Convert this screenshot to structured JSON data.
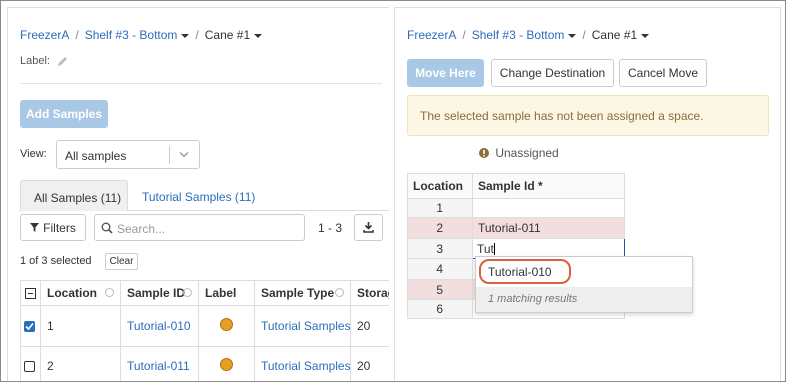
{
  "left": {
    "breadcrumb": {
      "freezer": "FreezerA",
      "shelf": "Shelf #3 - Bottom",
      "cane": "Cane #1"
    },
    "label_text": "Label:",
    "add_samples": "Add Samples",
    "view_label": "View:",
    "view_value": "All samples",
    "tabs": [
      {
        "label": "All Samples (11)"
      },
      {
        "label": "Tutorial Samples (11)"
      }
    ],
    "filters": "Filters",
    "search_placeholder": "Search...",
    "page_range": "1 - 3",
    "selected_text": "1 of 3 selected",
    "clear": "Clear",
    "columns": [
      "Location",
      "Sample ID",
      "Label",
      "Sample Type",
      "Storage"
    ],
    "rows": [
      {
        "location": "1",
        "sample_id": "Tutorial-010",
        "sample_type": "Tutorial Samples",
        "store": "20",
        "checked": true
      },
      {
        "location": "2",
        "sample_id": "Tutorial-011",
        "sample_type": "Tutorial Samples",
        "store": "20",
        "checked": false
      }
    ]
  },
  "right": {
    "breadcrumb": {
      "freezer": "FreezerA",
      "shelf": "Shelf #3 - Bottom",
      "cane": "Cane #1"
    },
    "move_here": "Move Here",
    "change_destination": "Change Destination",
    "cancel_move": "Cancel Move",
    "alert": "The selected sample has not been assigned a space.",
    "unassigned": "Unassigned",
    "loc_header": "Location",
    "sample_header": "Sample Id *",
    "loc_rows": [
      {
        "loc": "1",
        "sample": ""
      },
      {
        "loc": "2",
        "sample": "Tutorial-011"
      },
      {
        "loc": "3",
        "sample": "Tut"
      },
      {
        "loc": "4",
        "sample": ""
      },
      {
        "loc": "5",
        "sample": ""
      },
      {
        "loc": "6",
        "sample": ""
      }
    ],
    "suggestion": "Tutorial-010",
    "matching": "1 matching results"
  },
  "colors": {
    "accent": "#2a6ebb",
    "highlight_row": "#f2dede",
    "label_dot": "#e8a020",
    "callout": "#d9603b"
  }
}
